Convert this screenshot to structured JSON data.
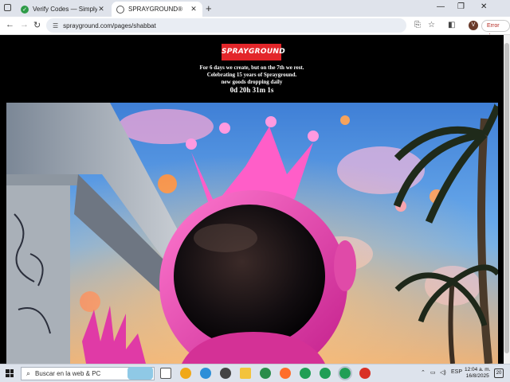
{
  "browser": {
    "tabs": [
      {
        "title": "Verify Codes — SimplyCodes",
        "favicon": "check-icon",
        "active": false
      },
      {
        "title": "SPRAYGROUND®",
        "favicon": "globe-icon",
        "active": true
      }
    ],
    "new_tab_label": "+",
    "url": "sprayground.com/pages/shabbat",
    "profile_initial": "V",
    "error_chip": "Error",
    "window_controls": [
      "minimize-icon",
      "restore-icon",
      "close-icon"
    ]
  },
  "page": {
    "logo_text": "SPRAYGROUND",
    "announcement_lines": [
      "For 6 days we create, but on the 7th we rest.",
      "Celebrating 15 years of Sprayground.",
      "new goods dropping daily"
    ],
    "countdown": "0d 20h 31m 1s",
    "hero_alt": "pink astronaut with crown among palm trees"
  },
  "taskbar": {
    "search_placeholder": "Buscar en la web & PC",
    "language": "ESP",
    "time": "12:04 a. m.",
    "date": "16/8/2025",
    "notification_count": "20",
    "apps": [
      "task-view-icon",
      "shield-app-icon",
      "edge-icon",
      "media-player-icon",
      "file-explorer-icon",
      "firefox-icon",
      "chrome-icon",
      "chrome-icon",
      "chrome-icon",
      "chrome-icon"
    ],
    "colors": {
      "accent": "#e3262a",
      "taskbar": "#dde3ec"
    }
  }
}
